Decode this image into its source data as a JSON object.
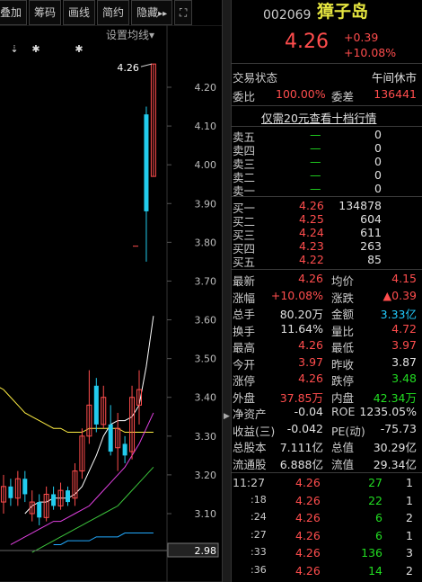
{
  "toolbar": {
    "btn1": "叠加",
    "btn2": "筹码",
    "btn3": "画线",
    "btn4": "简约",
    "btn5": "隐藏",
    "btn5_arrow": "▸▸",
    "expand_icon": "⛶"
  },
  "chart": {
    "settings_label": "设置均线",
    "settings_arrow": "▾",
    "high_marker": "4.26",
    "current_price_tag": "2.98",
    "y_ticks": [
      "4.20",
      "4.10",
      "4.00",
      "3.90",
      "3.80",
      "3.70",
      "3.60",
      "3.50",
      "3.40",
      "3.30",
      "3.20",
      "3.10"
    ],
    "markers": [
      "⇣",
      "✱",
      "✱"
    ]
  },
  "chart_data": {
    "type": "candlestick",
    "ylim": [
      2.98,
      4.29
    ],
    "y_ticks": [
      4.2,
      4.1,
      4.0,
      3.9,
      3.8,
      3.7,
      3.6,
      3.5,
      3.4,
      3.3,
      3.2,
      3.1
    ],
    "candles": [
      {
        "o": 3.05,
        "c": 3.13,
        "h": 3.16,
        "l": 3.0,
        "dir": "up"
      },
      {
        "o": 3.13,
        "c": 3.17,
        "h": 3.2,
        "l": 3.1,
        "dir": "up"
      },
      {
        "o": 3.17,
        "c": 3.14,
        "h": 3.19,
        "l": 3.12,
        "dir": "down"
      },
      {
        "o": 3.14,
        "c": 3.19,
        "h": 3.21,
        "l": 3.12,
        "dir": "up"
      },
      {
        "o": 3.19,
        "c": 3.15,
        "h": 3.21,
        "l": 3.13,
        "dir": "down"
      },
      {
        "o": 3.1,
        "c": 3.13,
        "h": 3.16,
        "l": 3.08,
        "dir": "up"
      },
      {
        "o": 3.13,
        "c": 3.09,
        "h": 3.15,
        "l": 3.07,
        "dir": "down"
      },
      {
        "o": 3.09,
        "c": 3.15,
        "h": 3.17,
        "l": 3.08,
        "dir": "up"
      },
      {
        "o": 3.15,
        "c": 3.12,
        "h": 3.17,
        "l": 3.11,
        "dir": "down"
      },
      {
        "o": 3.12,
        "c": 3.16,
        "h": 3.18,
        "l": 3.11,
        "dir": "up"
      },
      {
        "o": 3.16,
        "c": 3.13,
        "h": 3.17,
        "l": 3.12,
        "dir": "down"
      },
      {
        "o": 3.14,
        "c": 3.21,
        "h": 3.23,
        "l": 3.12,
        "dir": "up"
      },
      {
        "o": 3.21,
        "c": 3.3,
        "h": 3.32,
        "l": 3.19,
        "dir": "up"
      },
      {
        "o": 3.3,
        "c": 3.38,
        "h": 3.47,
        "l": 3.28,
        "dir": "up"
      },
      {
        "o": 3.43,
        "c": 3.33,
        "h": 3.45,
        "l": 3.31,
        "dir": "down"
      },
      {
        "o": 3.33,
        "c": 3.4,
        "h": 3.43,
        "l": 3.32,
        "dir": "up"
      },
      {
        "o": 3.33,
        "c": 3.26,
        "h": 3.38,
        "l": 3.25,
        "dir": "down"
      },
      {
        "o": 3.27,
        "c": 3.32,
        "h": 3.36,
        "l": 3.21,
        "dir": "up"
      },
      {
        "o": 3.28,
        "c": 3.25,
        "h": 3.3,
        "l": 3.23,
        "dir": "down"
      },
      {
        "o": 3.26,
        "c": 3.4,
        "h": 3.43,
        "l": 3.24,
        "dir": "up"
      },
      {
        "o": 3.38,
        "c": 3.42,
        "h": 3.47,
        "l": 3.33,
        "dir": "up"
      },
      {
        "o": 3.88,
        "c": 4.13,
        "h": 4.15,
        "l": 3.75,
        "dir": "down"
      },
      {
        "o": 3.97,
        "c": 4.26,
        "h": 4.26,
        "l": 3.97,
        "dir": "up"
      }
    ],
    "ma_lines": [
      {
        "color": "#ffffff",
        "values": [
          null,
          null,
          null,
          null,
          3.1,
          3.12,
          3.13,
          3.13,
          3.14,
          3.14,
          3.14,
          3.15,
          3.17,
          3.21,
          3.25,
          3.3,
          3.33,
          3.34,
          3.34,
          3.35,
          3.38,
          3.48,
          3.61
        ]
      },
      {
        "color": "#ffee44",
        "values": [
          3.43,
          3.42,
          3.4,
          3.38,
          3.36,
          3.35,
          3.34,
          3.33,
          3.32,
          3.32,
          3.31,
          3.31,
          3.31,
          3.32,
          3.32,
          3.32,
          3.32,
          3.32,
          3.31,
          3.31,
          3.31,
          3.31,
          3.31
        ]
      },
      {
        "color": "#e040e0",
        "values": [
          null,
          null,
          3.02,
          3.03,
          3.04,
          3.05,
          3.06,
          3.07,
          3.08,
          3.08,
          3.09,
          3.1,
          3.11,
          3.12,
          3.14,
          3.16,
          3.18,
          3.2,
          3.22,
          3.25,
          3.28,
          3.32,
          3.36
        ]
      },
      {
        "color": "#3cc43c",
        "values": [
          null,
          null,
          null,
          null,
          null,
          3.0,
          3.01,
          3.02,
          3.03,
          3.04,
          3.05,
          3.06,
          3.07,
          3.08,
          3.09,
          3.1,
          3.11,
          3.12,
          3.14,
          3.16,
          3.18,
          3.2,
          3.22
        ]
      },
      {
        "color": "#22aaff",
        "values": [
          null,
          null,
          null,
          null,
          null,
          null,
          null,
          null,
          3.02,
          3.02,
          3.03,
          3.03,
          3.03,
          3.03,
          3.04,
          3.04,
          3.04,
          3.04,
          3.05,
          3.05,
          3.05,
          3.05,
          3.05
        ]
      }
    ]
  },
  "quote": {
    "code": "002069",
    "name": "獐子岛",
    "price": "4.26",
    "change": "+0.39",
    "change_pct": "+10.08%"
  },
  "status": {
    "label": "交易状态",
    "value": "午间休市",
    "ratio_label": "委比",
    "ratio_value": "100.00%",
    "diff_label": "委差",
    "diff_value": "136441",
    "promo": "仅需20元查看十档行情"
  },
  "sells": [
    {
      "label": "卖五",
      "price": "—",
      "vol": "0"
    },
    {
      "label": "卖四",
      "price": "—",
      "vol": "0"
    },
    {
      "label": "卖三",
      "price": "—",
      "vol": "0"
    },
    {
      "label": "卖二",
      "price": "—",
      "vol": "0"
    },
    {
      "label": "卖一",
      "price": "—",
      "vol": "0"
    }
  ],
  "buys": [
    {
      "label": "买一",
      "price": "4.26",
      "vol": "134878"
    },
    {
      "label": "买二",
      "price": "4.25",
      "vol": "604"
    },
    {
      "label": "买三",
      "price": "4.24",
      "vol": "611"
    },
    {
      "label": "买四",
      "price": "4.23",
      "vol": "263"
    },
    {
      "label": "买五",
      "price": "4.22",
      "vol": "85"
    }
  ],
  "stats": [
    {
      "l1": "最新",
      "v1": "4.26",
      "c1": "red",
      "l2": "均价",
      "v2": "4.15",
      "c2": "red"
    },
    {
      "l1": "涨幅",
      "v1": "+10.08%",
      "c1": "red",
      "l2": "涨跌",
      "v2": "▲0.39",
      "c2": "red"
    },
    {
      "l1": "总手",
      "v1": "80.20万",
      "c1": "white",
      "l2": "金额",
      "v2": "3.33亿",
      "c2": "cyan"
    },
    {
      "l1": "换手",
      "v1": "11.64%",
      "c1": "white",
      "l2": "量比",
      "v2": "4.72",
      "c2": "red"
    },
    {
      "l1": "最高",
      "v1": "4.26",
      "c1": "red",
      "l2": "最低",
      "v2": "3.97",
      "c2": "red"
    },
    {
      "l1": "今开",
      "v1": "3.97",
      "c1": "red",
      "l2": "昨收",
      "v2": "3.87",
      "c2": "white"
    },
    {
      "l1": "涨停",
      "v1": "4.26",
      "c1": "red",
      "l2": "跌停",
      "v2": "3.48",
      "c2": "green"
    },
    {
      "l1": "外盘",
      "v1": "37.85万",
      "c1": "red",
      "l2": "内盘",
      "v2": "42.34万",
      "c2": "green"
    },
    {
      "l1": "净资产",
      "v1": "-0.04",
      "c1": "white",
      "l2": "ROE",
      "v2": "1235.05%",
      "c2": "white"
    },
    {
      "l1": "收益(三)",
      "v1": "-0.042",
      "c1": "white",
      "l2": "PE(动)",
      "v2": "-75.73",
      "c2": "white"
    },
    {
      "l1": "总股本",
      "v1": "7.111亿",
      "c1": "white",
      "l2": "总值",
      "v2": "30.29亿",
      "c2": "white"
    },
    {
      "l1": "流通股",
      "v1": "6.888亿",
      "c1": "white",
      "l2": "流值",
      "v2": "29.34亿",
      "c2": "white"
    }
  ],
  "ticks": [
    {
      "time": "11:27",
      "price": "4.26",
      "vol": "27",
      "count": "1"
    },
    {
      "time": ":18",
      "price": "4.26",
      "vol": "22",
      "count": "1"
    },
    {
      "time": ":24",
      "price": "4.26",
      "vol": "6",
      "count": "2"
    },
    {
      "time": ":27",
      "price": "4.26",
      "vol": "6",
      "count": "1"
    },
    {
      "time": ":33",
      "price": "4.26",
      "vol": "136",
      "count": "3"
    },
    {
      "time": ":36",
      "price": "4.26",
      "vol": "14",
      "count": "2"
    }
  ],
  "divider_arrow": "▶"
}
